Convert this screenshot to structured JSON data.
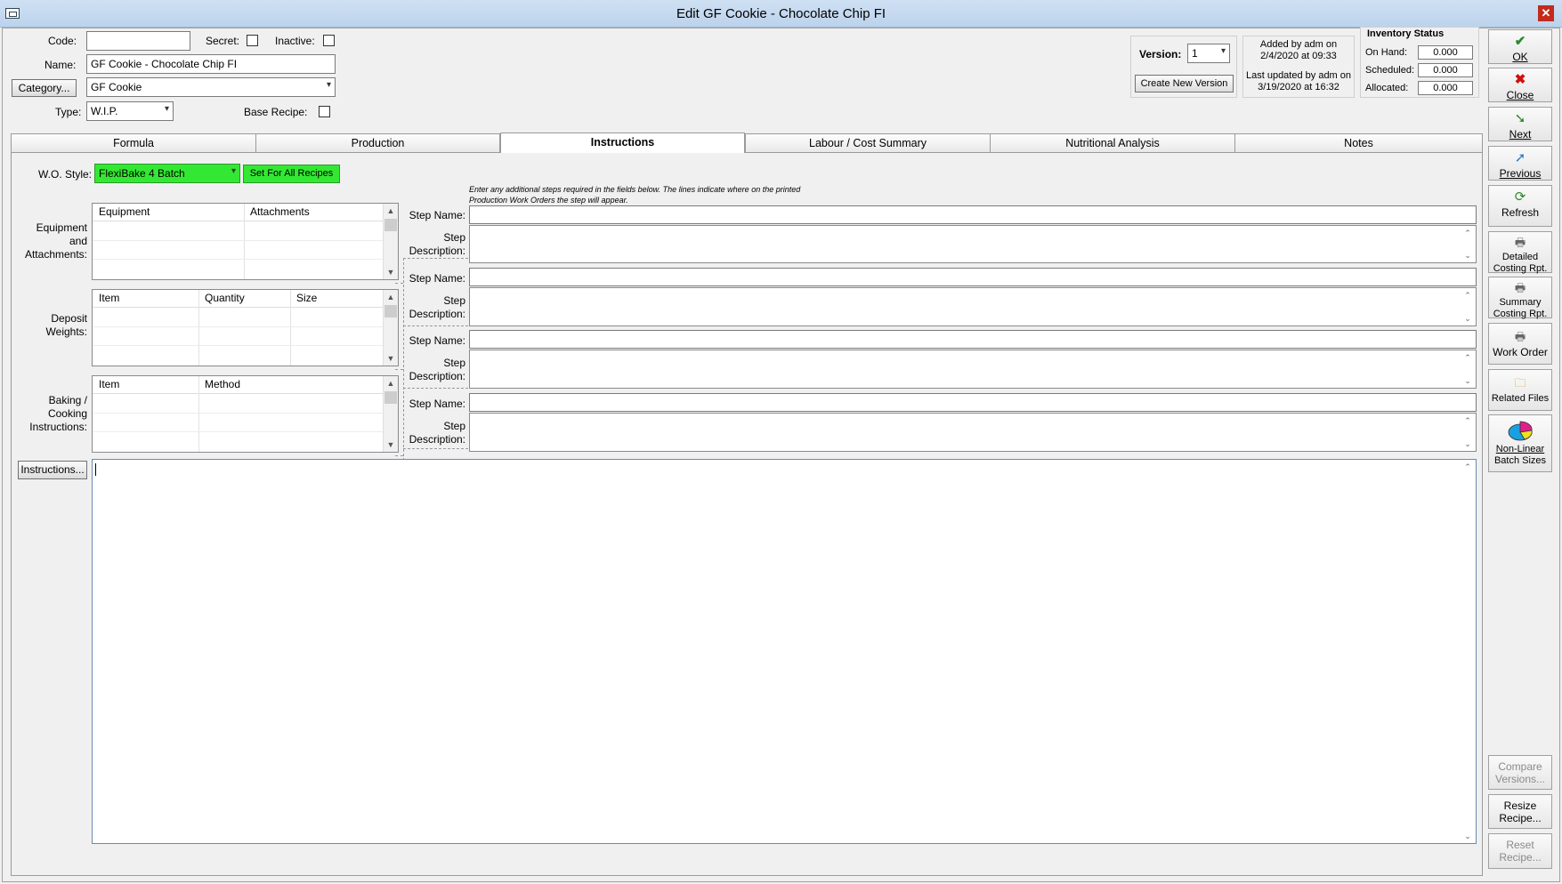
{
  "window": {
    "title": "Edit GF Cookie - Chocolate Chip FI"
  },
  "header": {
    "code_label": "Code:",
    "code_value": "",
    "secret_label": "Secret:",
    "inactive_label": "Inactive:",
    "name_label": "Name:",
    "name_value": "GF Cookie - Chocolate Chip FI",
    "category_button": "Category...",
    "category_value": "GF Cookie",
    "type_label": "Type:",
    "type_value": "W.I.P.",
    "base_recipe_label": "Base Recipe:",
    "version_label": "Version:",
    "version_value": "1",
    "create_version_button": "Create New Version",
    "added_line1": "Added by adm on",
    "added_line2": "2/4/2020 at 09:33",
    "updated_line1": "Last updated by adm on",
    "updated_line2": "3/19/2020 at 16:32"
  },
  "inventory": {
    "title": "Inventory Status",
    "on_hand_label": "On Hand:",
    "on_hand": "0.000",
    "scheduled_label": "Scheduled:",
    "scheduled": "0.000",
    "allocated_label": "Allocated:",
    "allocated": "0.000"
  },
  "tabs": [
    "Formula",
    "Production",
    "Instructions",
    "Labour / Cost Summary",
    "Nutritional Analysis",
    "Notes"
  ],
  "active_tab": "Instructions",
  "instructions": {
    "wo_style_label": "W.O. Style:",
    "wo_style_value": "FlexiBake 4 Batch",
    "set_all_button": "Set For All Recipes",
    "hint_line1": "Enter any additional steps required in the fields below. The lines indicate where on the printed",
    "hint_line2": "Production Work Orders the step will appear.",
    "equipment_label_1": "Equipment",
    "equipment_label_2": "and",
    "equipment_label_3": "Attachments:",
    "equipment_cols": [
      "Equipment",
      "Attachments"
    ],
    "deposit_label_1": "Deposit",
    "deposit_label_2": "Weights:",
    "deposit_cols": [
      "Item",
      "Quantity",
      "Size"
    ],
    "baking_label_1": "Baking /",
    "baking_label_2": "Cooking",
    "baking_label_3": "Instructions:",
    "baking_cols": [
      "Item",
      "Method"
    ],
    "step_name_label": "Step Name:",
    "step_desc_label_1": "Step",
    "step_desc_label_2": "Description:",
    "instructions_button": "Instructions...",
    "instructions_text": ""
  },
  "toolbar": {
    "ok": "OK",
    "close": "Close",
    "next": "Next",
    "previous": "Previous",
    "refresh": "Refresh",
    "detailed_1": "Detailed",
    "detailed_2": "Costing Rpt.",
    "summary_1": "Summary",
    "summary_2": "Costing Rpt.",
    "work_order": "Work Order",
    "related_files": "Related Files",
    "nonlinear_1": "Non-Linear",
    "nonlinear_2": "Batch Sizes",
    "compare_1": "Compare",
    "compare_2": "Versions...",
    "resize_1": "Resize",
    "resize_2": "Recipe...",
    "reset_1": "Reset",
    "reset_2": "Recipe..."
  },
  "colors": {
    "green_accent": "#33e833",
    "ok_green": "#2a8a2a",
    "close_red": "#d01010"
  }
}
